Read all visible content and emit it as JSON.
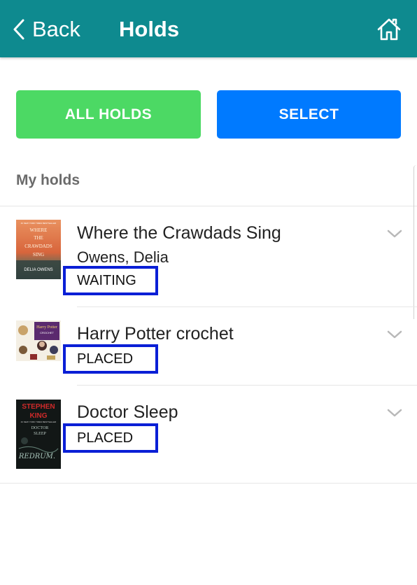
{
  "header": {
    "back_label": "Back",
    "title": "Holds",
    "background": "#0e8a8f",
    "icons": {
      "back": "chevron-left-icon",
      "home": "home-icon"
    }
  },
  "actions": {
    "all_holds_label": "ALL HOLDS",
    "all_holds_color": "#4cd964",
    "select_label": "SELECT",
    "select_color": "#007aff"
  },
  "section": {
    "title": "My holds"
  },
  "holds": [
    {
      "title": "Where the Crawdads Sing",
      "author": "Owens, Delia",
      "status": "WAITING",
      "cover": {
        "top_text": "#1 NEW YORK TIMES BESTSELLER",
        "lines": [
          "WHERE",
          "THE",
          "CRAWDADS",
          "SING"
        ],
        "author_text": "DELIA OWENS"
      }
    },
    {
      "title": "Harry Potter crochet",
      "author": "",
      "status": "PLACED",
      "cover": {
        "top_text": "Harry Potter",
        "sub_text": "CROCHET"
      }
    },
    {
      "title": "Doctor Sleep",
      "author": "",
      "status": "PLACED",
      "cover": {
        "author_line1": "STEPHEN",
        "author_line2": "KING",
        "top_text": "#1 NEW YORK TIMES BESTSELLER",
        "title_line1": "DOCTOR",
        "title_line2": "SLEEP",
        "script_text": "REDRUM."
      }
    }
  ],
  "status_highlight_color": "#0a1fd6"
}
